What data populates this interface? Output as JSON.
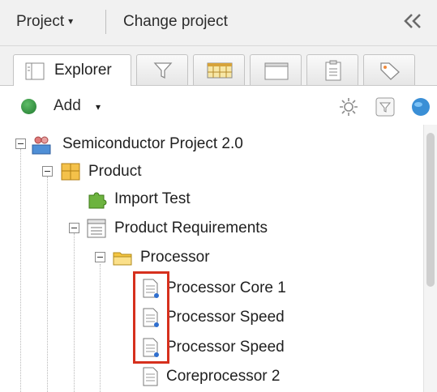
{
  "topbar": {
    "project_label": "Project",
    "project_caret": "▾",
    "change_project_label": "Change project",
    "collapse_glyph": "«"
  },
  "tabs": [
    {
      "id": "explorer",
      "label": "Explorer",
      "icon": "explorer-icon",
      "active": true
    },
    {
      "id": "filter",
      "label": "",
      "icon": "filter-icon",
      "active": false
    },
    {
      "id": "grid",
      "label": "",
      "icon": "grid-icon",
      "active": false
    },
    {
      "id": "window",
      "label": "",
      "icon": "window-icon",
      "active": false
    },
    {
      "id": "clipboard",
      "label": "",
      "icon": "clipboard-icon",
      "active": false
    },
    {
      "id": "tag",
      "label": "",
      "icon": "tag-icon",
      "active": false
    }
  ],
  "toolbar": {
    "add_label": "Add",
    "add_caret": "▾",
    "icons": [
      "gear-icon",
      "filter-toggle-icon",
      "globe-icon"
    ]
  },
  "tree": {
    "items": [
      {
        "label": "Semiconductor Project 2.0",
        "icon": "project-icon",
        "expanded": true
      },
      {
        "label": "Product",
        "icon": "product-icon",
        "expanded": true
      },
      {
        "label": "Import Test",
        "icon": "puzzle-icon",
        "expanded": null
      },
      {
        "label": "Product Requirements",
        "icon": "requirements-list-icon",
        "expanded": true
      },
      {
        "label": "Processor",
        "icon": "folder-icon",
        "expanded": true
      },
      {
        "label": "Processor Core 1",
        "icon": "document-icon",
        "highlighted": true
      },
      {
        "label": "Processor Speed",
        "icon": "document-icon",
        "highlighted": true
      },
      {
        "label": "Processor Speed",
        "icon": "document-icon",
        "highlighted": true
      },
      {
        "label": "Coreprocessor 2",
        "icon": "document-icon",
        "highlighted": false
      }
    ]
  },
  "colors": {
    "highlight_border": "#d6301d",
    "add_green": "#2e8b3a",
    "folder_yellow": "#f5c542"
  }
}
